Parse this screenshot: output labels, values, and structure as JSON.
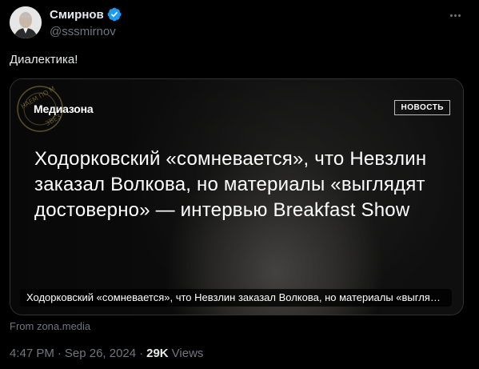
{
  "author": {
    "display_name": "Смирнов",
    "handle": "@sssmirnov",
    "verified_color": "#1d9bf0"
  },
  "icons": {
    "verified": "verified-badge-icon",
    "more": "more-options-icon",
    "avatar": "profile-avatar"
  },
  "tweet": {
    "text": "Диалектика!"
  },
  "card": {
    "brand": "Медиазона",
    "badge": "НОВОСТЬ",
    "headline": "Ходорковский «сомневается», что Невзлин заказал Волкова, но материалы «выглядят достоверно» — интервью Breakfast Show",
    "caption": "Ходорковский «сомневается», что Невзлин заказал Волкова, но материалы «выглядят достоверно» — интервью Breakfast Show",
    "stamp_text_top": "НАЕМ ПО М",
    "stamp_text_bottom": "ЗВЕЗ"
  },
  "source": "From zona.media",
  "meta": {
    "time": "4:47 PM",
    "separator": "·",
    "date": "Sep 26, 2024",
    "views_count": "29K",
    "views_label": "Views"
  }
}
